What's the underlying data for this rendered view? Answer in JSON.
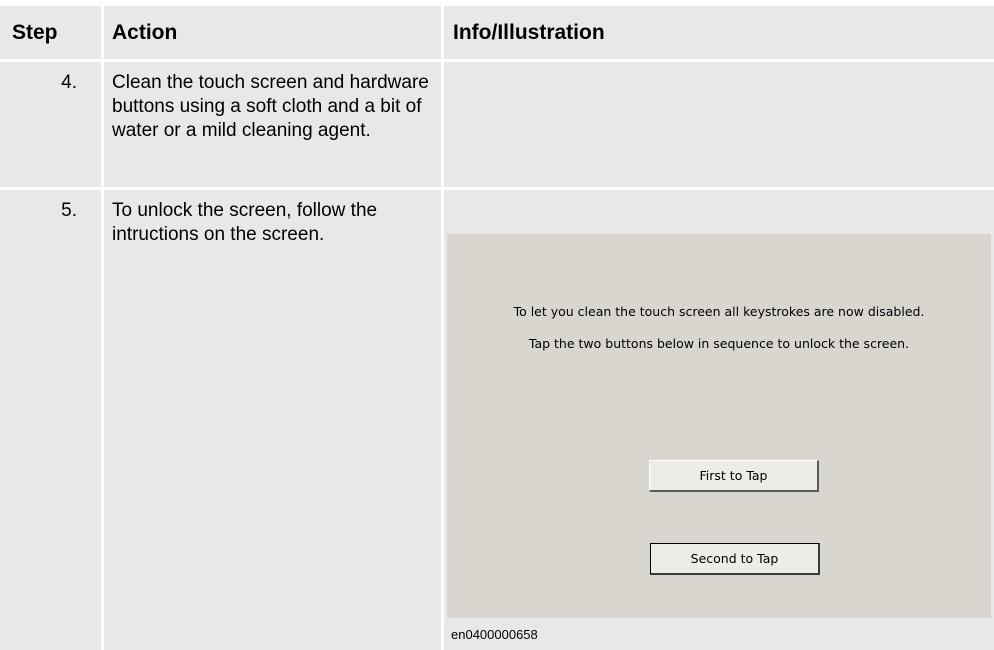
{
  "table": {
    "headers": {
      "step": "Step",
      "action": "Action",
      "info": "Info/Illustration"
    },
    "rows": [
      {
        "step": "4.",
        "action": "Clean the touch screen and hardware buttons using a soft cloth and a bit of water or a mild cleaning agent."
      },
      {
        "step": "5.",
        "action": "To unlock the screen, follow the intructions on the screen."
      }
    ]
  },
  "illustration": {
    "message_line_1": "To let you clean the touch screen all keystrokes are now disabled.",
    "message_line_2": "Tap the two buttons below in sequence to unlock the screen.",
    "first_button_label": "First to Tap",
    "second_button_label": "Second to Tap",
    "figure_id": "en0400000658"
  },
  "colors": {
    "cell_background": "#e8e8e8",
    "screen_background": "#d9d6d0"
  }
}
